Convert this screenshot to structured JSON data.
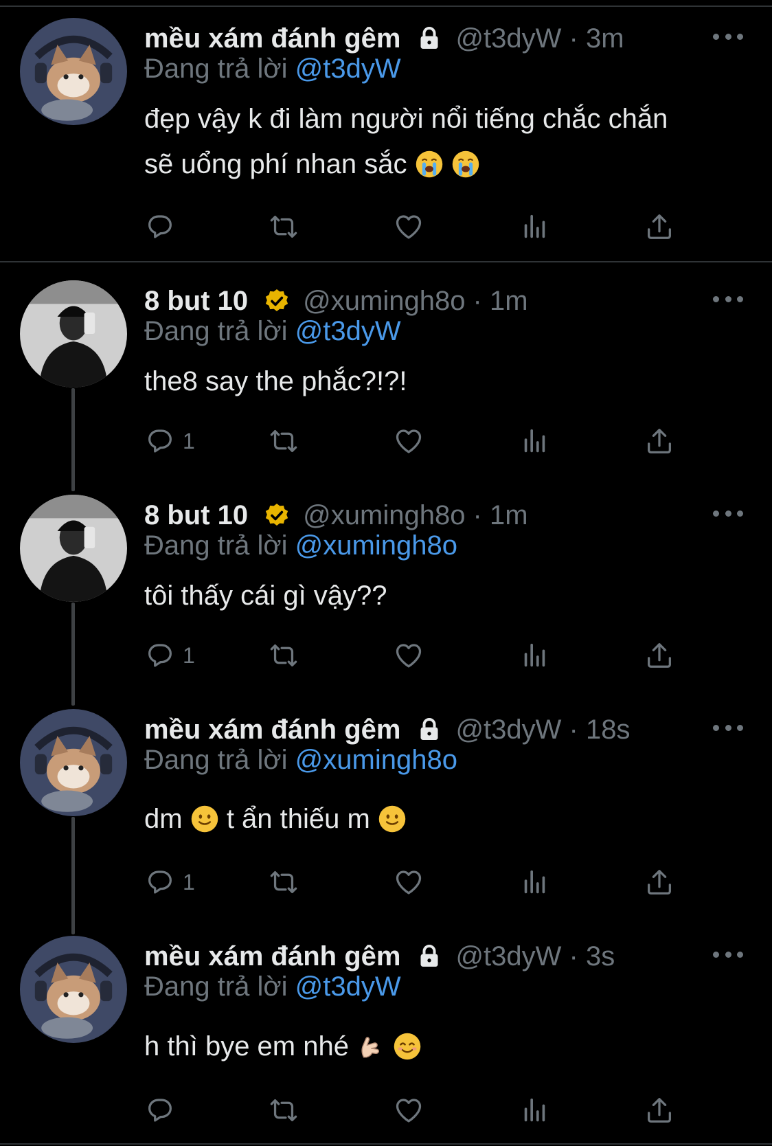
{
  "tweets": [
    {
      "name": "mều xám đánh gêm",
      "handle": "@t3dyW",
      "time": "3m",
      "handle_time": "@t3dyW · 3m",
      "replying_prefix": "Đang trả lời",
      "replying_to": "@t3dyW",
      "text_line1": "đẹp vậy k đi làm người nổi tiếng chắc chắn",
      "text_line2": "sẽ uổng phí nhan sắc",
      "reply_count": ""
    },
    {
      "name": "8 but 10",
      "handle": "@xumingh8o",
      "time": "1m",
      "handle_time": "@xumingh8o · 1m",
      "replying_prefix": "Đang trả lời",
      "replying_to": "@t3dyW",
      "text_line1": "the8 say the phắc?!?!",
      "reply_count": "1"
    },
    {
      "name": "8 but 10",
      "handle": "@xumingh8o",
      "time": "1m",
      "handle_time": "@xumingh8o · 1m",
      "replying_prefix": "Đang trả lời",
      "replying_to": "@xumingh8o",
      "text_line1": "tôi thấy cái gì vậy??",
      "reply_count": "1"
    },
    {
      "name": "mều xám đánh gêm",
      "handle": "@t3dyW",
      "time": "18s",
      "handle_time": "@t3dyW · 18s",
      "replying_prefix": "Đang trả lời",
      "replying_to": "@xumingh8o",
      "text_a": "dm",
      "text_b": "t ẩn thiếu m",
      "reply_count": "1"
    },
    {
      "name": "mều xám đánh gêm",
      "handle": "@t3dyW",
      "time": "3s",
      "handle_time": "@t3dyW · 3s",
      "replying_prefix": "Đang trả lời",
      "replying_to": "@t3dyW",
      "text_line1": "h thì bye em nhé",
      "reply_count": ""
    }
  ],
  "icons": {
    "reply": "reply-icon",
    "retweet": "retweet-icon",
    "like": "like-icon",
    "analytics": "analytics-icon",
    "share": "share-icon",
    "more": "more-icon",
    "lock": "lock-icon",
    "verified": "verified-badge-icon"
  },
  "colors": {
    "background": "#000000",
    "text": "#e7e9ea",
    "secondary": "#6e767d",
    "mention": "#4a99e9",
    "verified": "#e8b400"
  }
}
